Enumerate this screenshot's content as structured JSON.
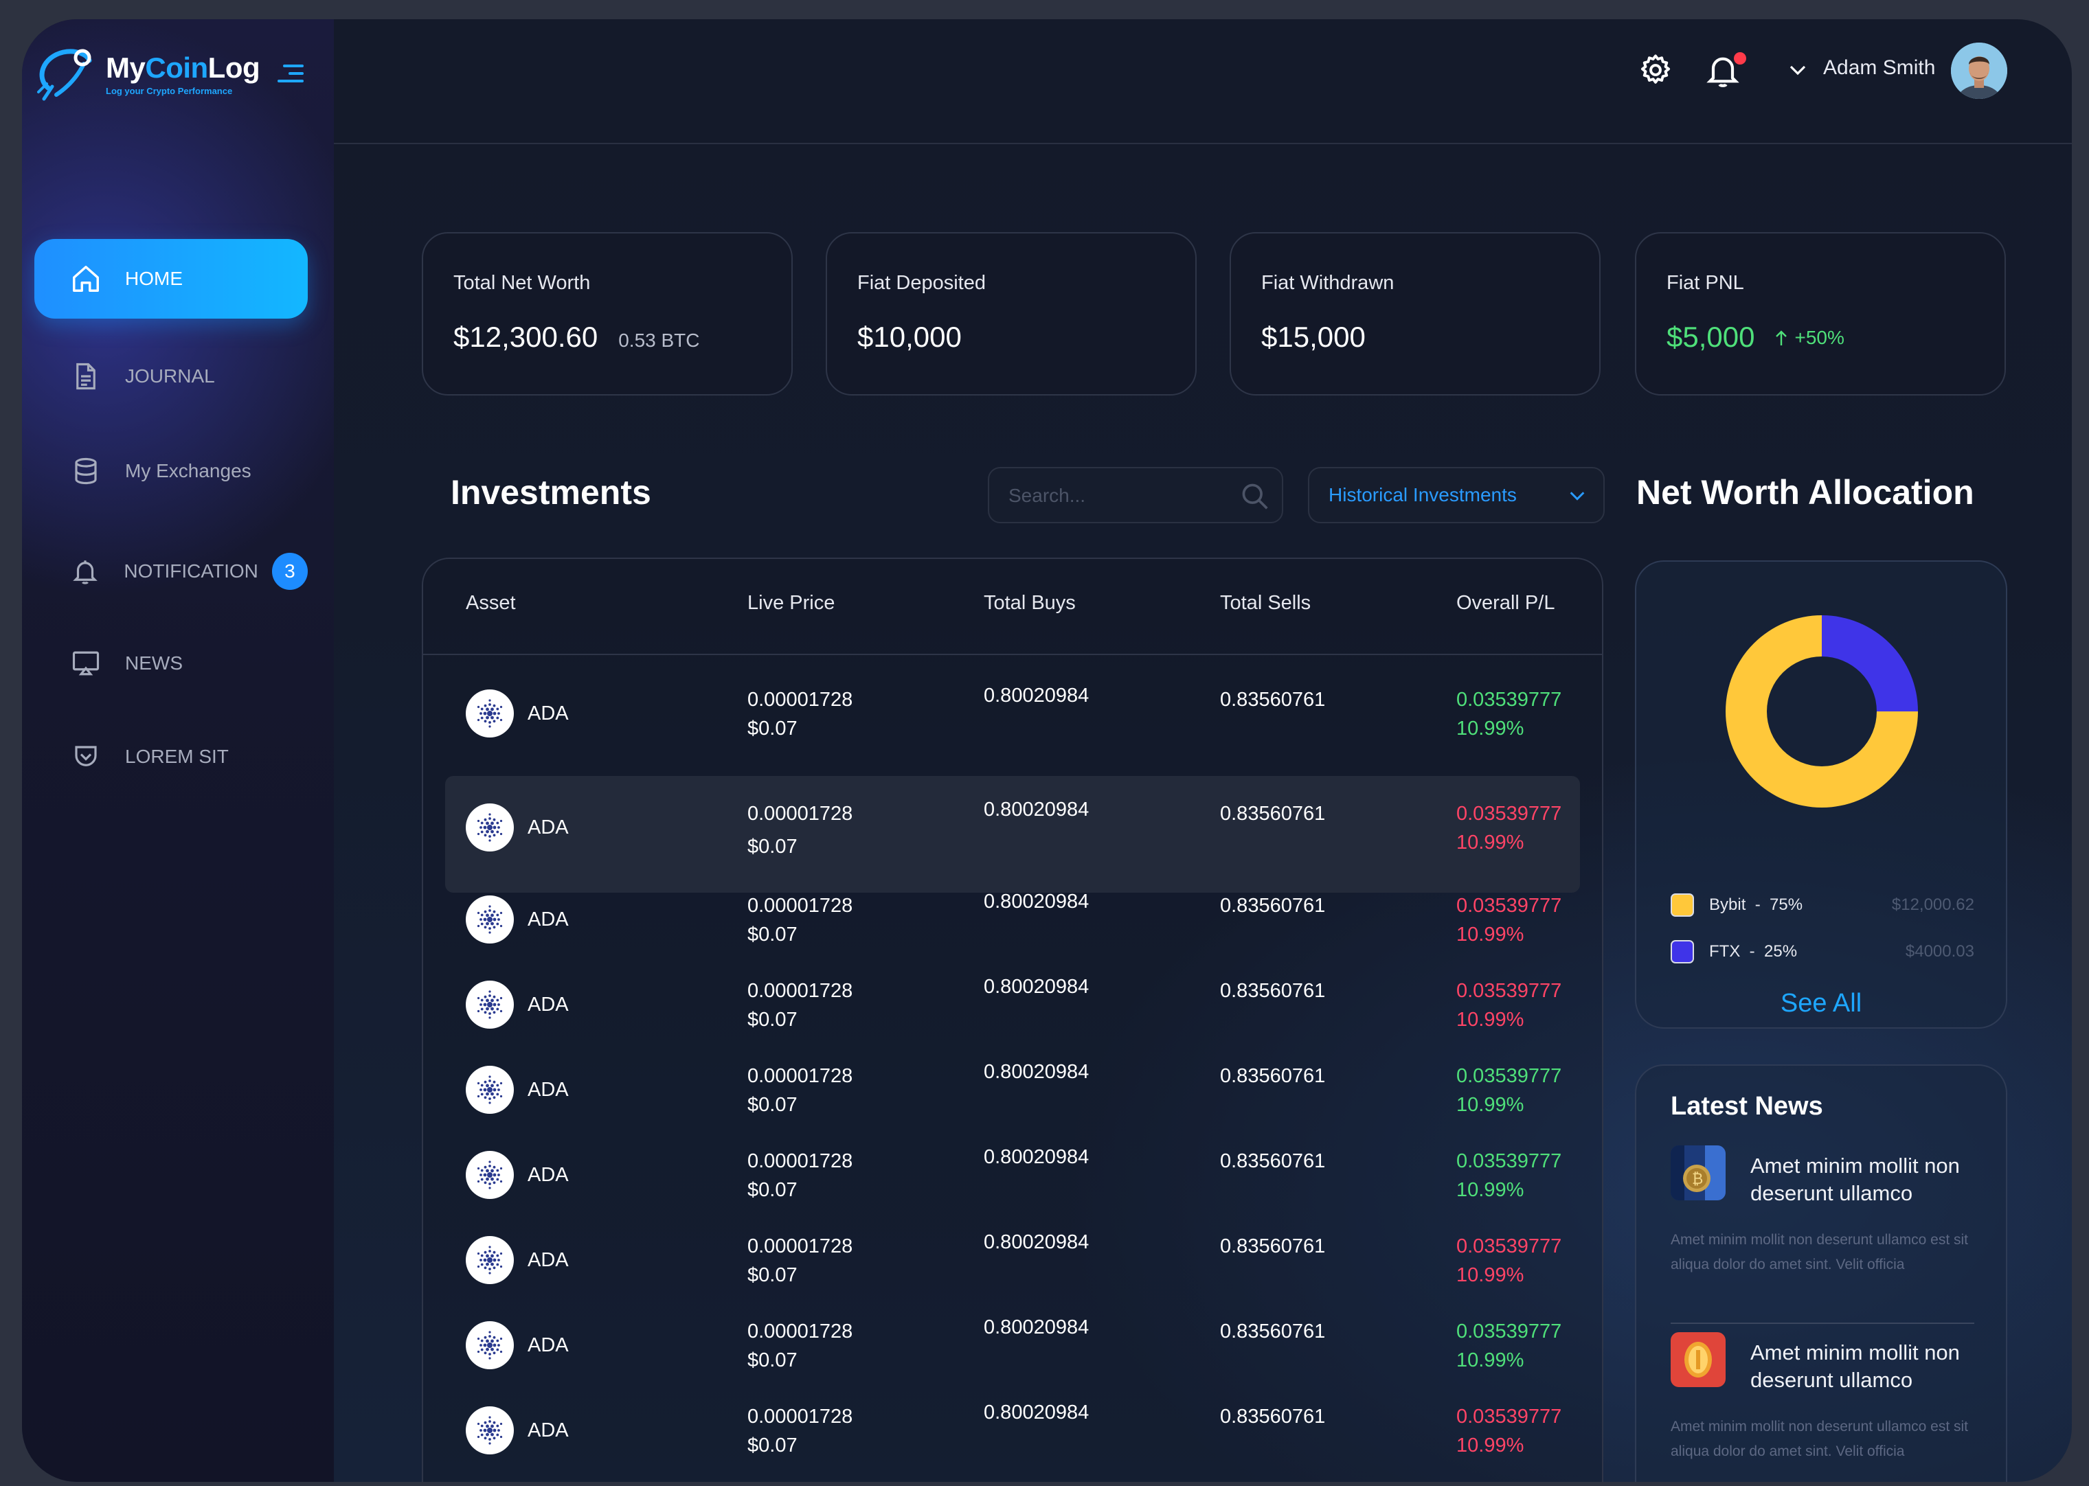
{
  "brand": {
    "title_part1": "My",
    "title_part2": "Coin",
    "title_part3": "Log",
    "tagline": "Log your Crypto Performance"
  },
  "sidebar": {
    "items": [
      {
        "label": "HOME",
        "icon": "home-icon",
        "active": true
      },
      {
        "label": "JOURNAL",
        "icon": "document-icon"
      },
      {
        "label": "My Exchanges",
        "icon": "database-icon"
      },
      {
        "label": "NOTIFICATION",
        "icon": "bell-icon",
        "badge": "3"
      },
      {
        "label": "NEWS",
        "icon": "monitor-icon"
      },
      {
        "label": "LOREM SIT",
        "icon": "pocket-icon"
      }
    ]
  },
  "header": {
    "user_name": "Adam Smith",
    "has_notification": true
  },
  "stats": [
    {
      "label": "Total Net Worth",
      "value": "$12,300.60",
      "sub": "0.53 BTC"
    },
    {
      "label": "Fiat Deposited",
      "value": "$10,000"
    },
    {
      "label": "Fiat Withdrawn",
      "value": "$15,000"
    },
    {
      "label": "Fiat PNL",
      "value": "$5,000",
      "change": "+50%"
    }
  ],
  "investments": {
    "title": "Investments",
    "search_placeholder": "Search...",
    "filter_label": "Historical Investments",
    "columns": [
      "Asset",
      "Live Price",
      "Total Buys",
      "Total Sells",
      "Overall P/L"
    ],
    "rows": [
      {
        "asset": "ADA",
        "price": "0.00001728",
        "price_usd": "$0.07",
        "buys": "0.80020984",
        "sells": "0.83560761",
        "pl": "0.03539777",
        "pl_pct": "10.99%",
        "positive": true
      },
      {
        "asset": "ADA",
        "price": "0.00001728",
        "price_usd": "$0.07",
        "buys": "0.80020984",
        "sells": "0.83560761",
        "pl": "0.03539777",
        "pl_pct": "10.99%",
        "positive": false,
        "highlighted": true
      },
      {
        "asset": "ADA",
        "price": "0.00001728",
        "price_usd": "$0.07",
        "buys": "0.80020984",
        "sells": "0.83560761",
        "pl": "0.03539777",
        "pl_pct": "10.99%",
        "positive": false
      },
      {
        "asset": "ADA",
        "price": "0.00001728",
        "price_usd": "$0.07",
        "buys": "0.80020984",
        "sells": "0.83560761",
        "pl": "0.03539777",
        "pl_pct": "10.99%",
        "positive": false
      },
      {
        "asset": "ADA",
        "price": "0.00001728",
        "price_usd": "$0.07",
        "buys": "0.80020984",
        "sells": "0.83560761",
        "pl": "0.03539777",
        "pl_pct": "10.99%",
        "positive": true
      },
      {
        "asset": "ADA",
        "price": "0.00001728",
        "price_usd": "$0.07",
        "buys": "0.80020984",
        "sells": "0.83560761",
        "pl": "0.03539777",
        "pl_pct": "10.99%",
        "positive": true
      },
      {
        "asset": "ADA",
        "price": "0.00001728",
        "price_usd": "$0.07",
        "buys": "0.80020984",
        "sells": "0.83560761",
        "pl": "0.03539777",
        "pl_pct": "10.99%",
        "positive": false
      },
      {
        "asset": "ADA",
        "price": "0.00001728",
        "price_usd": "$0.07",
        "buys": "0.80020984",
        "sells": "0.83560761",
        "pl": "0.03539777",
        "pl_pct": "10.99%",
        "positive": true
      },
      {
        "asset": "ADA",
        "price": "0.00001728",
        "price_usd": "$0.07",
        "buys": "0.80020984",
        "sells": "0.83560761",
        "pl": "0.03539777",
        "pl_pct": "10.99%",
        "positive": false
      }
    ]
  },
  "allocation": {
    "title": "Net Worth Allocation",
    "segments": [
      {
        "name": "Bybit",
        "percent": "75%",
        "amount": "$12,000.62",
        "color": "#ffc83a",
        "value": 75
      },
      {
        "name": "FTX",
        "percent": "25%",
        "amount": "$4000.03",
        "color": "#3f34e8",
        "value": 25
      }
    ],
    "see_all": "See All"
  },
  "news": {
    "title": "Latest News",
    "items": [
      {
        "headline": "Amet minim mollit non deserunt ullamco",
        "body": "Amet minim mollit non deserunt ullamco est sit aliqua dolor do amet sint. Velit officia",
        "thumb": "bitcoin-image"
      },
      {
        "headline": "Amet minim mollit non deserunt ullamco",
        "body": "Amet minim mollit non deserunt ullamco est sit aliqua dolor do amet sint. Velit officia",
        "thumb": "coin-image"
      }
    ]
  },
  "colors": {
    "accent": "#1ea7ff",
    "positive": "#4fe07a",
    "negative": "#ff4466"
  }
}
